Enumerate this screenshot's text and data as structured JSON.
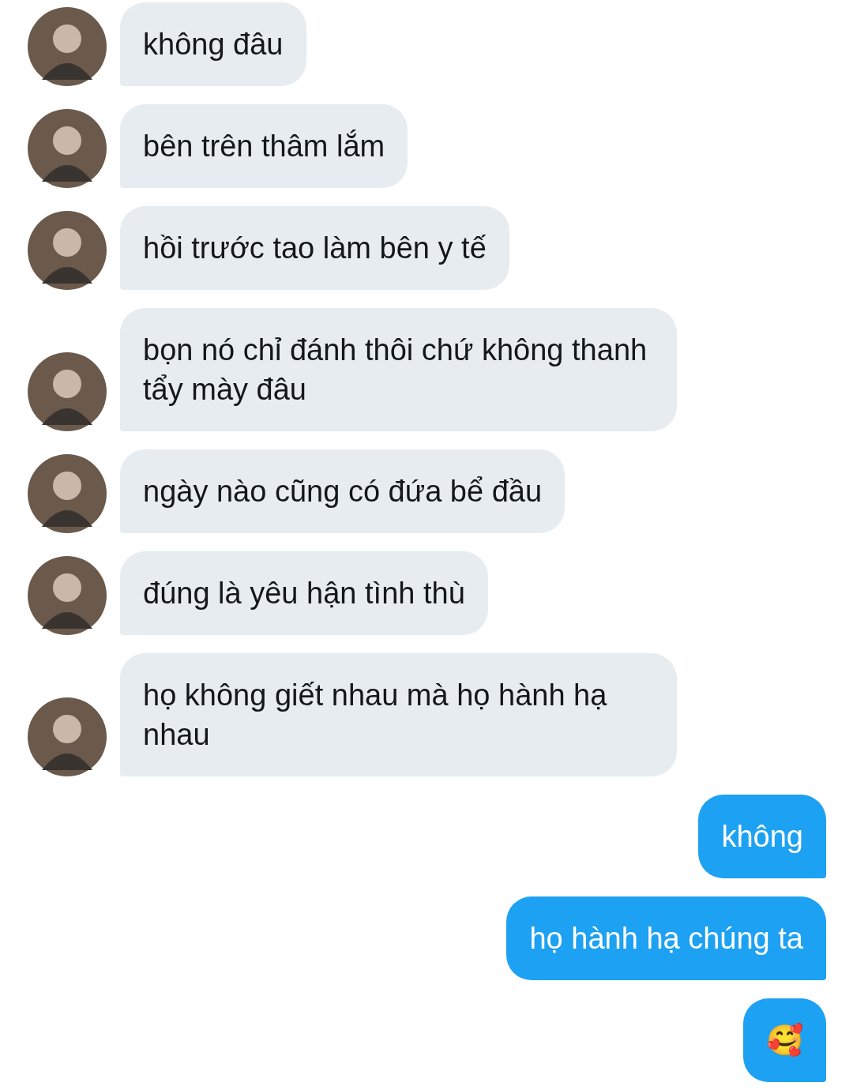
{
  "messages": [
    {
      "kind": "received",
      "text": "không đâu"
    },
    {
      "kind": "received",
      "text": "bên trên thâm lắm"
    },
    {
      "kind": "received",
      "text": "hồi trước tao làm bên y tế"
    },
    {
      "kind": "received",
      "text": "bọn nó chỉ đánh thôi chứ không thanh tẩy mày đâu"
    },
    {
      "kind": "received",
      "text": "ngày nào cũng có đứa bể đầu"
    },
    {
      "kind": "received",
      "text": "đúng là yêu hận tình thù"
    },
    {
      "kind": "received",
      "text": "họ không giết nhau mà họ hành hạ nhau"
    },
    {
      "kind": "sent",
      "text": "không"
    },
    {
      "kind": "sent",
      "text": "họ hành hạ chúng ta"
    },
    {
      "kind": "sent",
      "text": "🥰"
    }
  ]
}
